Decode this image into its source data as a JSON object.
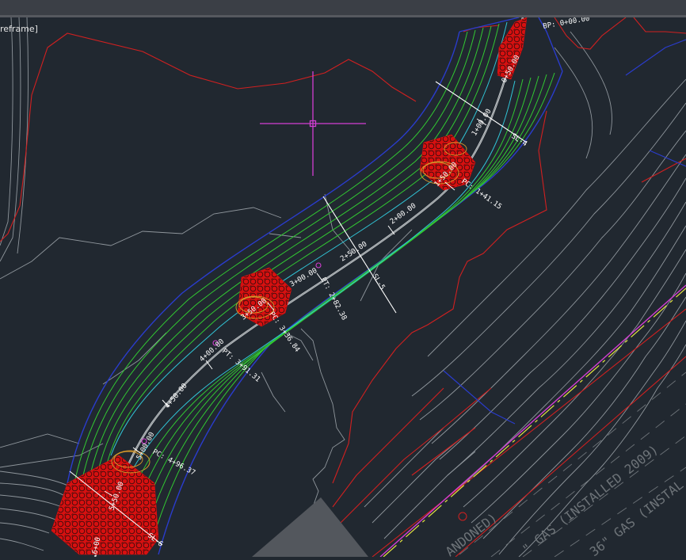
{
  "viewport": {
    "visual_style_label": "reframe]"
  },
  "colors": {
    "background": "#212830",
    "contour_gray": "#8f969c",
    "boundary_red": "#d12020",
    "grading_green": "#32c832",
    "grading_cyan": "#31c5d6",
    "road_blue": "#2a3ccc",
    "riprap_red": "#d71010",
    "crosshair_magenta": "#d23fd2",
    "pipeline_yellow": "#e4e442",
    "label_white": "#ffffff"
  },
  "stations": {
    "bp": "BP: 0+00.00",
    "s050": "0+50.00",
    "s100": "1+00.00",
    "s150": "1+50.00",
    "s200": "2+00.00",
    "s250": "2+50.00",
    "s300": "3+00.00",
    "s350": "3+50.00",
    "s400": "4+00.00",
    "s450": "4+50.00",
    "s500": "5+00.00",
    "s550": "5+50.00",
    "s600": "6+00"
  },
  "annotations": {
    "sl4": "SL-4",
    "sl5": "SL-5",
    "sl6": "SL-6",
    "pc1": "PC: 1+41.15",
    "pt1": "PT: 2+82.38",
    "pc2": "PC: 3+36.84",
    "pt2": "PT: 3+91.31",
    "pc3": "PC: 4+96.37",
    "gas1": "\" GAS (INSTALLED 2009)",
    "gas2": "36\" GAS (INSTAL",
    "abandoned": "ANDONED)"
  },
  "icons": {
    "crosshair": "crosshair-cursor-icon"
  }
}
